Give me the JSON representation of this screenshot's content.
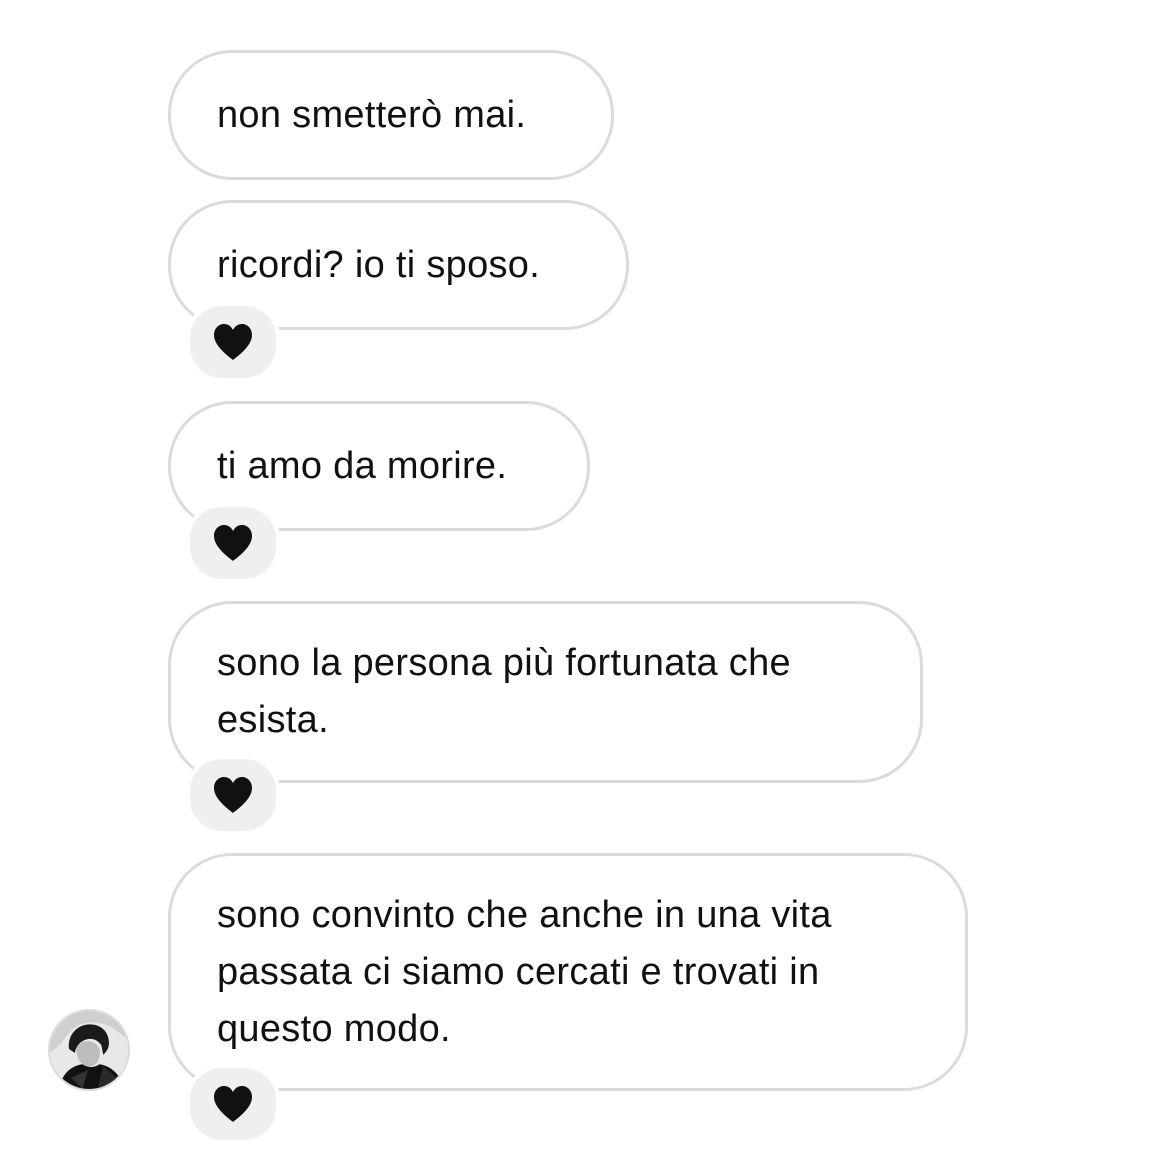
{
  "conversation": {
    "messages": [
      {
        "text": "non smetterò mai.",
        "reaction": null
      },
      {
        "text": "ricordi? io ti sposo.",
        "reaction": "black-heart"
      },
      {
        "text": "ti amo da morire.",
        "reaction": "black-heart"
      },
      {
        "text": "sono la persona più fortunata che\nesista.",
        "reaction": "black-heart"
      },
      {
        "text": "sono convinto che anche in una vita\npassata ci siamo cercati e trovati in\nquesto modo.",
        "reaction": "black-heart"
      }
    ],
    "sender_avatar": "profile-photo-grayscale"
  },
  "colors": {
    "bubble_border": "#dbdbdb",
    "reaction_bg": "#efefef",
    "heart": "#111111",
    "text": "#111111"
  }
}
